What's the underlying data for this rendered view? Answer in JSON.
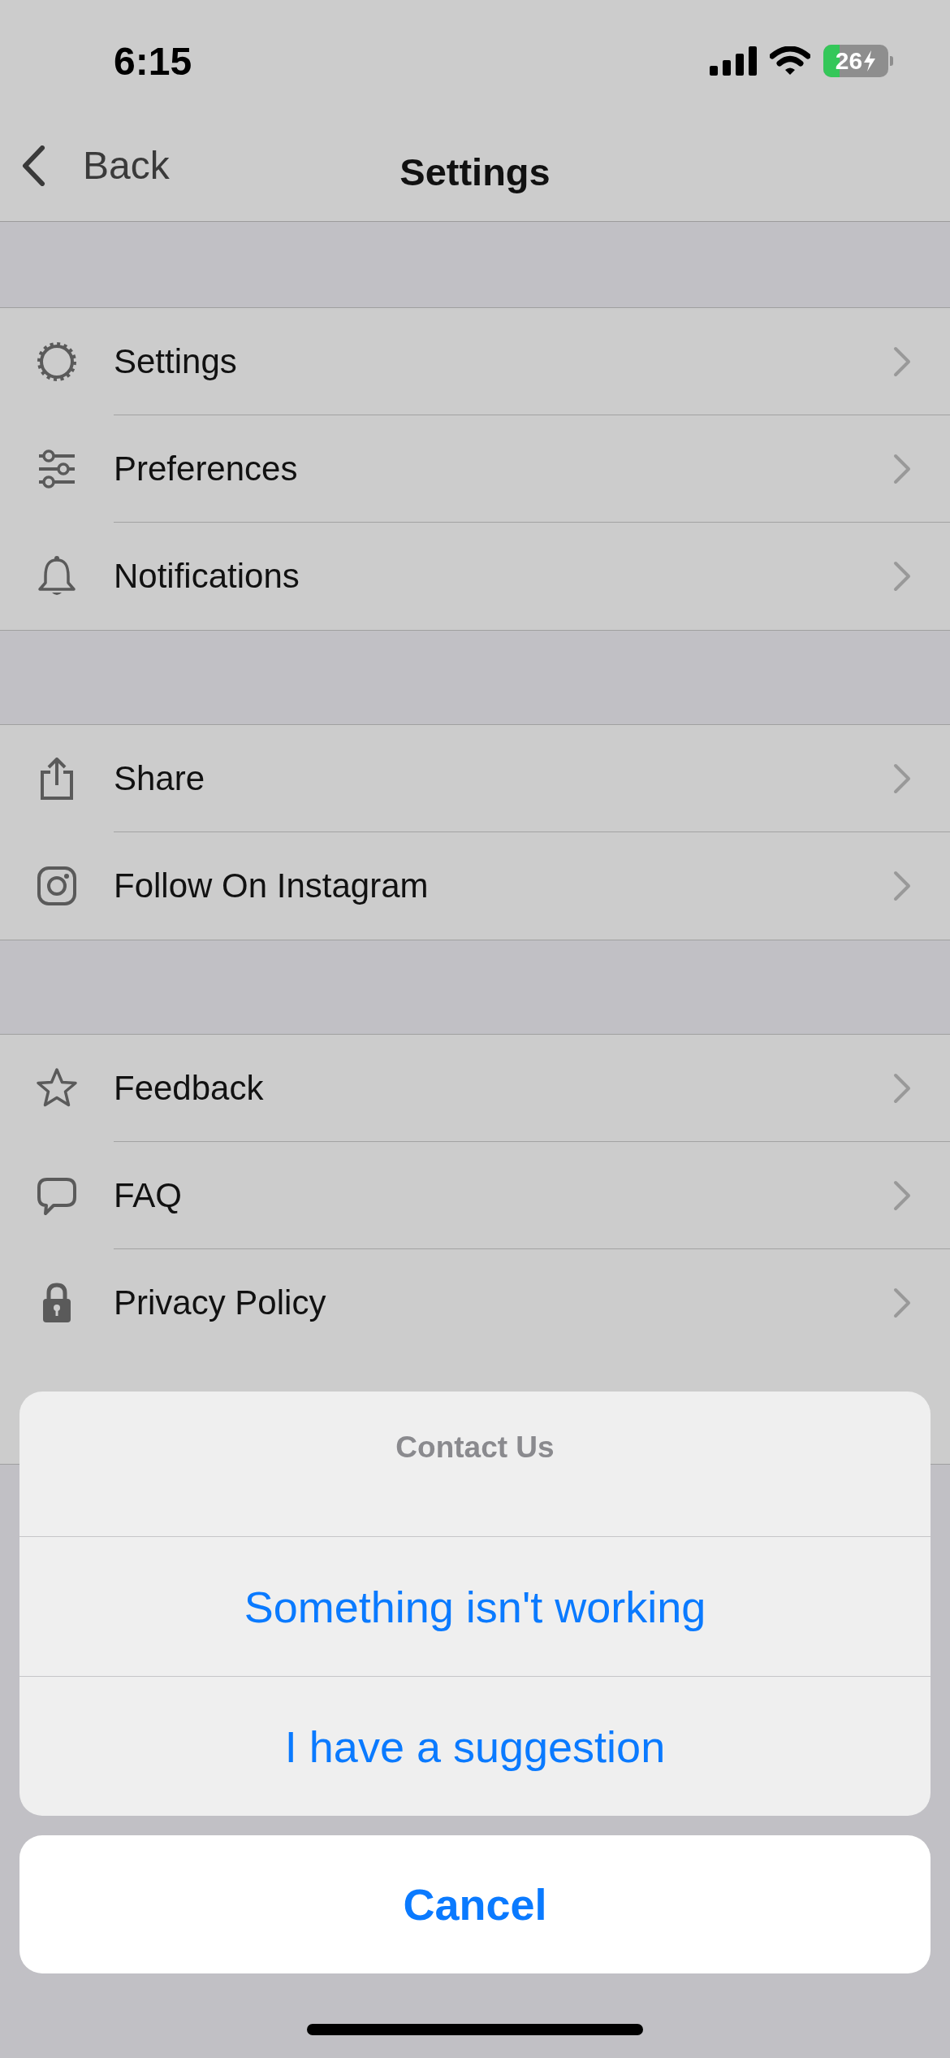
{
  "status_bar": {
    "time": "6:15",
    "battery": "26"
  },
  "nav": {
    "back": "Back",
    "title": "Settings"
  },
  "sections": [
    {
      "rows": [
        {
          "label": "Settings"
        },
        {
          "label": "Preferences"
        },
        {
          "label": "Notifications"
        }
      ]
    },
    {
      "rows": [
        {
          "label": "Share"
        },
        {
          "label": "Follow On Instagram"
        }
      ]
    },
    {
      "rows": [
        {
          "label": "Feedback"
        },
        {
          "label": "FAQ"
        },
        {
          "label": "Privacy Policy"
        }
      ]
    }
  ],
  "action_sheet": {
    "title": "Contact Us",
    "options": [
      "Something isn't working",
      "I have a suggestion"
    ],
    "cancel": "Cancel"
  }
}
